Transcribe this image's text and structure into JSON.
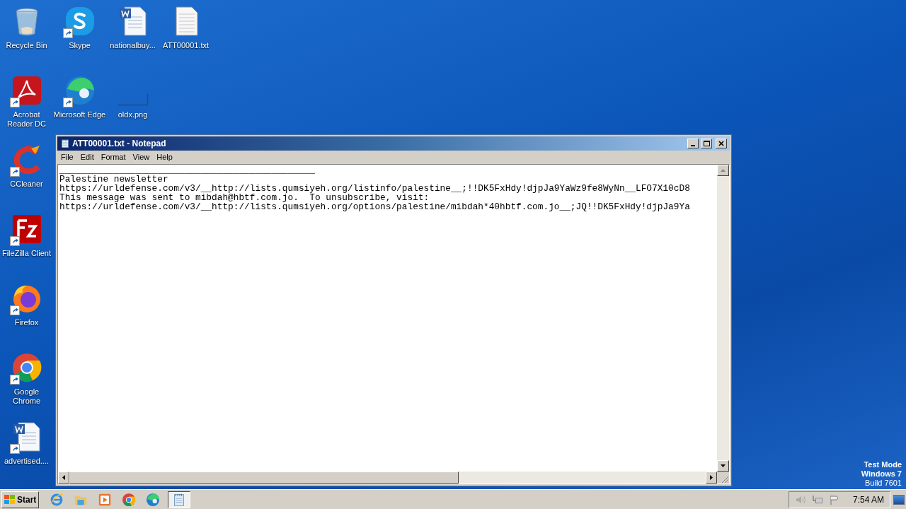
{
  "desktop": {
    "icons": [
      {
        "label": "Recycle Bin",
        "kind": "recycle",
        "shortcut": false
      },
      {
        "label": "Skype",
        "kind": "skype",
        "shortcut": true
      },
      {
        "label": "nationalbuy...",
        "kind": "word",
        "shortcut": false
      },
      {
        "label": "ATT00001.txt",
        "kind": "text",
        "shortcut": false
      },
      {
        "label": "Acrobat Reader DC",
        "kind": "acrobat",
        "shortcut": true
      },
      {
        "label": "Microsoft Edge",
        "kind": "edge",
        "shortcut": true
      },
      {
        "label": "oldx.png",
        "kind": "image",
        "shortcut": false
      },
      {
        "label": "CCleaner",
        "kind": "ccleaner",
        "shortcut": true
      },
      {
        "label": "FileZilla Client",
        "kind": "filezilla",
        "shortcut": true
      },
      {
        "label": "Firefox",
        "kind": "firefox",
        "shortcut": true
      },
      {
        "label": "Google Chrome",
        "kind": "chrome",
        "shortcut": true
      },
      {
        "label": "advertised....",
        "kind": "word",
        "shortcut": true
      }
    ],
    "watermark_lines": [
      "Test Mode",
      "Windows 7",
      "Build 7601"
    ]
  },
  "window": {
    "title": "ATT00001.txt - Notepad",
    "menu": [
      "File",
      "Edit",
      "Format",
      "View",
      "Help"
    ],
    "lines": [
      "_______________________________________________",
      "Palestine newsletter",
      "https://urldefense.com/v3/__http://lists.qumsiyeh.org/listinfo/palestine__;!!DK5FxHdy!djpJa9YaWz9fe8WyNn__LFO7X10cD8",
      "This message was sent to mibdah@hbtf.com.jo.  To unsubscribe, visit:",
      "https://urldefense.com/v3/__http://lists.qumsiyeh.org/options/palestine/mibdah*40hbtf.com.jo__;JQ!!DK5FxHdy!djpJa9Ya"
    ]
  },
  "taskbar": {
    "start": "Start",
    "quick_launch": [
      {
        "kind": "ie"
      },
      {
        "kind": "explorer"
      },
      {
        "kind": "media"
      },
      {
        "kind": "chrome"
      },
      {
        "kind": "edge"
      }
    ],
    "tasks": [
      {
        "kind": "notepad",
        "selected": true
      }
    ],
    "clock": "7:54 AM"
  }
}
